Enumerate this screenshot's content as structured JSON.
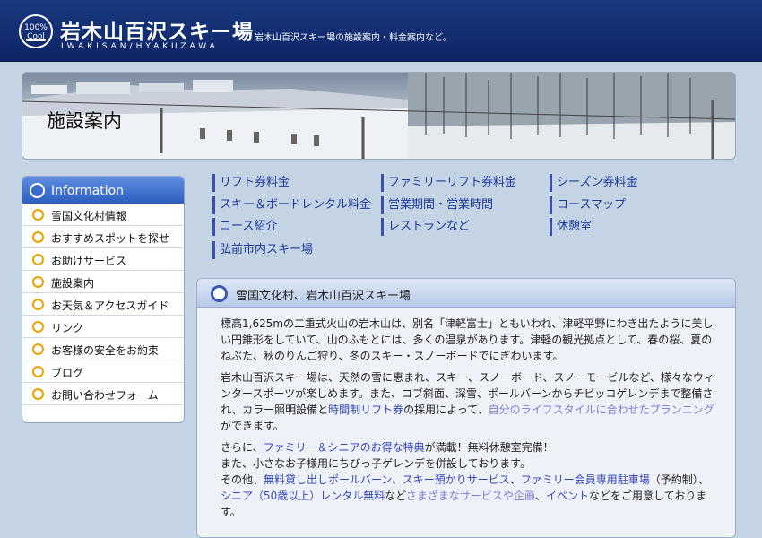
{
  "header": {
    "logo_badge_top": "100%",
    "logo_badge_bottom": "Cool",
    "title": "岩木山百沢スキー場",
    "subtitle": "IWAKISAN/HYAKUZAWA",
    "description": "岩木山百沢スキー場の施設案内・料金案内など。"
  },
  "banner": {
    "title": "施設案内"
  },
  "sidebar": {
    "heading": "Information",
    "items": [
      {
        "label": "雪国文化村情報"
      },
      {
        "label": "おすすめスポットを探せ"
      },
      {
        "label": "お助けサービス"
      },
      {
        "label": "施設案内"
      },
      {
        "label": "お天気＆アクセスガイド"
      },
      {
        "label": "リンク"
      },
      {
        "label": "お客様の安全をお約束"
      },
      {
        "label": "ブログ"
      },
      {
        "label": "お問い合わせフォーム"
      }
    ]
  },
  "links": [
    {
      "label": "リフト券料金"
    },
    {
      "label": "ファミリーリフト券料金"
    },
    {
      "label": "シーズン券料金"
    },
    {
      "label": "スキー＆ボードレンタル料金"
    },
    {
      "label": "営業期間・営業時間"
    },
    {
      "label": "コースマップ"
    },
    {
      "label": "コース紹介"
    },
    {
      "label": "レストランなど"
    },
    {
      "label": "休憩室"
    },
    {
      "label": "弘前市内スキー場"
    }
  ],
  "content": {
    "heading": "雪国文化村、岩木山百沢スキー場",
    "p1": "標高1,625mの二重式火山の岩木山は、別名「津軽富士」ともいわれ、津軽平野にわき出たように美しい円錐形をしていて、山のふもとには、多くの温泉があります。津軽の観光拠点として、春の桜、夏のねぶた、秋のりんご狩り、冬のスキー・スノーボードでにぎわいます。",
    "p2a": "岩木山百沢スキー場は、天然の雪に恵まれ、スキー、スノーボード、スノーモービルなど、様々なウィンタースポーツが楽しめます。また、コブ斜面、深雪、ポールバーンからチビッコゲレンデまで整備され、カラー照明設備と",
    "p2_link1": "時間制リフト券",
    "p2b": "の採用によって、",
    "p2_link2": "自分のライフスタイルに合わせたプランニング",
    "p2c": "ができます。",
    "p3_a": "さらに、",
    "p3_link1": "ファミリー＆シニアのお得な特典",
    "p3_b": "が満載！無料休憩室完備！",
    "p3_line2": "また、小さなお子様用にちびっ子ゲレンデを併設しております。",
    "p3_c": "その他、",
    "p3_link2": "無料貸し出しポールバーン",
    "p3_d": "、",
    "p3_link3": "スキー預かりサービス",
    "p3_e": "、",
    "p3_link4": "ファミリー会員専用駐車場",
    "p3_f": "（予約制）、",
    "p3_link5": "シニア（50歳以上）レンタル無料",
    "p3_g": "など",
    "p3_link6": "さまざまなサービスや企画",
    "p3_h": "、",
    "p3_link7": "イベント",
    "p3_i": "などをご用意しております。"
  },
  "colors": {
    "header_bg": "#0d2466",
    "sidebar_head": "#2d5ec0",
    "link": "#1e3a9c",
    "bullet": "#f0a000"
  }
}
